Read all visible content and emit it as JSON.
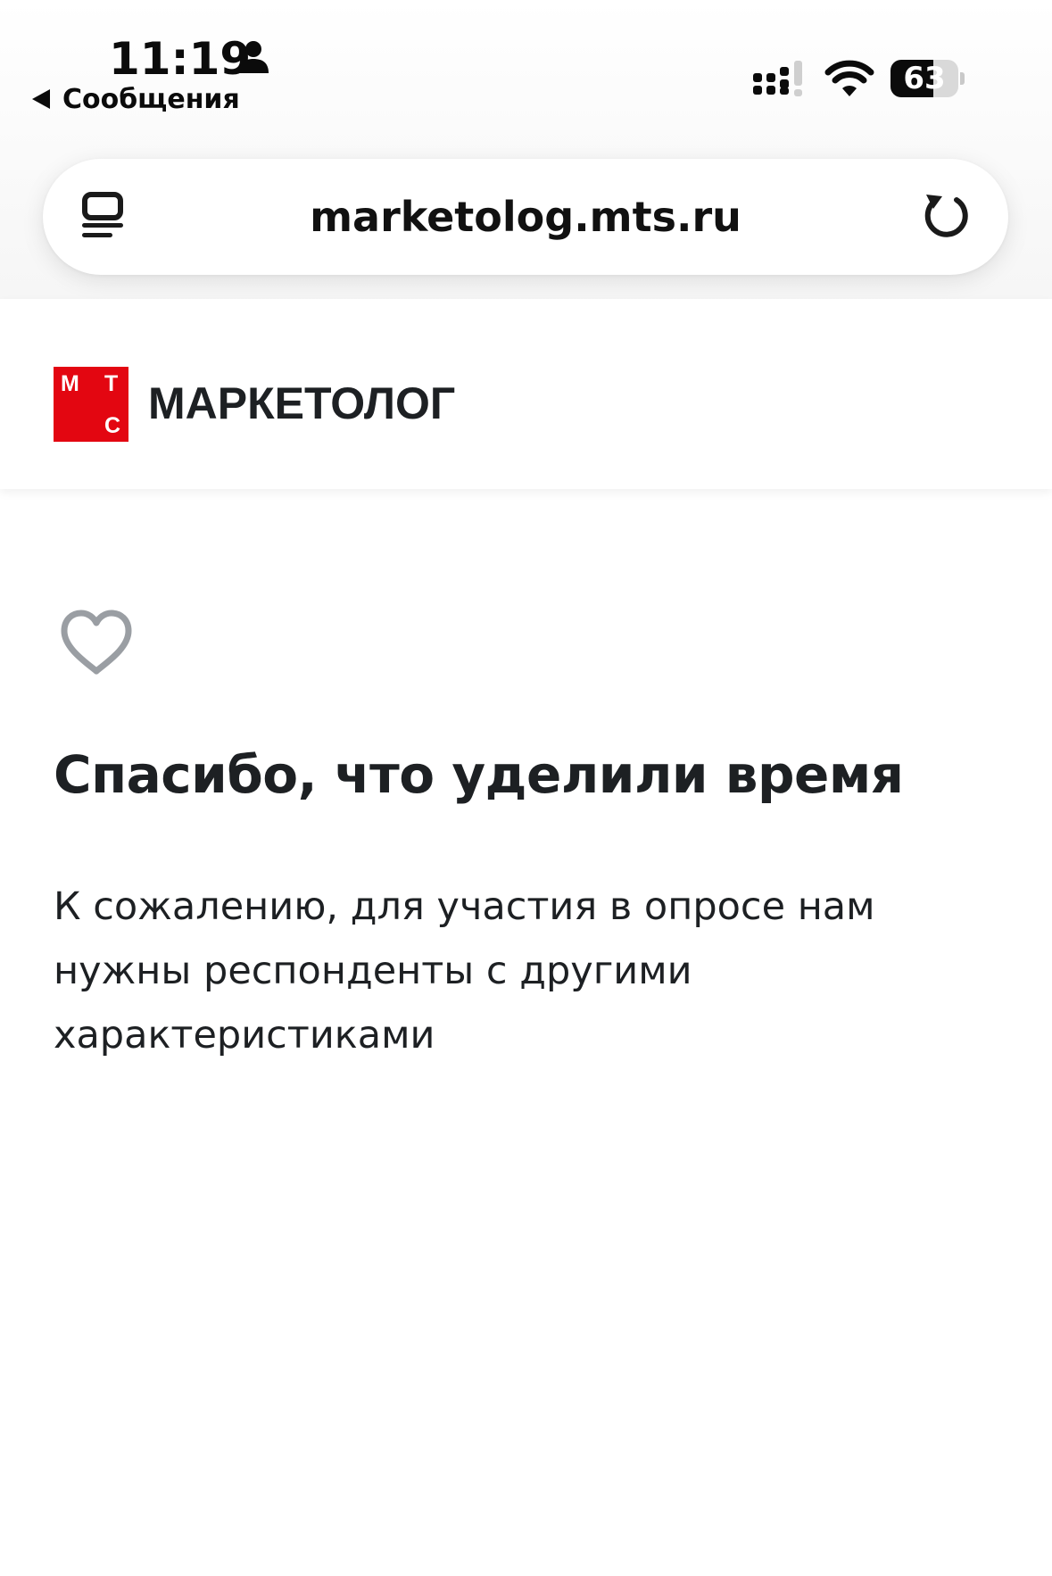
{
  "status_bar": {
    "time": "11:19",
    "back_label": "Сообщения",
    "battery_level": "63",
    "battery_fraction": 0.63
  },
  "browser": {
    "url": "marketolog.mts.ru"
  },
  "site": {
    "logo_letters": [
      "М",
      "Т",
      "С"
    ],
    "brand_name": "МАРКЕТОЛОГ",
    "brand_color": "#e30611"
  },
  "content": {
    "title": "Спасибо, что уделили время",
    "message": "К сожалению, для участия в опросе нам нужны респонденты с другими характеристиками"
  }
}
